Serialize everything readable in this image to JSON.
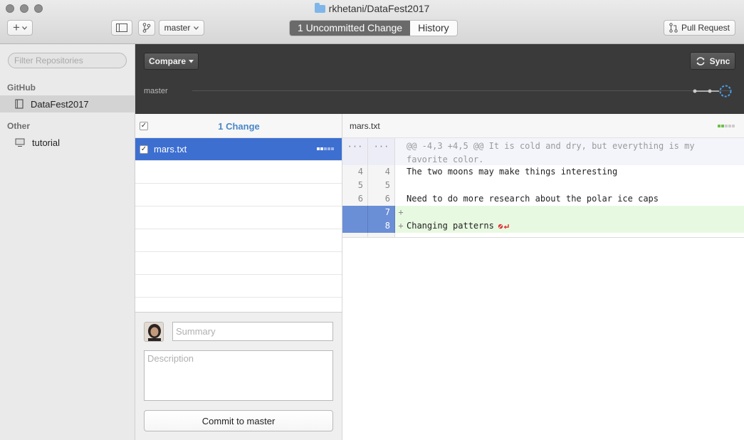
{
  "window": {
    "title": "rkhetani/DataFest2017"
  },
  "toolbar": {
    "add_label": "+",
    "branch_label": "master",
    "tab_changes": "1 Uncommitted Change",
    "tab_history": "History",
    "pull_request_label": "Pull Request"
  },
  "sidebar": {
    "filter_placeholder": "Filter Repositories",
    "groups": [
      {
        "title": "GitHub",
        "repos": [
          {
            "name": "DataFest2017",
            "selected": true
          }
        ]
      },
      {
        "title": "Other",
        "repos": [
          {
            "name": "tutorial",
            "selected": false
          }
        ]
      }
    ]
  },
  "header": {
    "compare_label": "Compare",
    "sync_label": "Sync",
    "branch_name": "master"
  },
  "changes": {
    "count_label": "1 Change",
    "files": [
      {
        "name": "mars.txt",
        "checked": true,
        "selected": true
      }
    ]
  },
  "commit": {
    "summary_placeholder": "Summary",
    "description_placeholder": "Description",
    "button_label": "Commit to master"
  },
  "diff": {
    "filename": "mars.txt",
    "hunk_header_line1": "@@ -4,3 +4,5 @@ It is cold and dry, but everything is my",
    "hunk_header_line2": "favorite color.",
    "gutter_ellipsis": "···",
    "lines": [
      {
        "old": "4",
        "new": "4",
        "sign": "",
        "text": "The two moons may make things interesting"
      },
      {
        "old": "5",
        "new": "5",
        "sign": "",
        "text": ""
      },
      {
        "old": "6",
        "new": "6",
        "sign": "",
        "text": "Need to do more research about the polar ice caps"
      },
      {
        "old": "",
        "new": "7",
        "sign": "+",
        "text": ""
      },
      {
        "old": "",
        "new": "8",
        "sign": "+",
        "text": "Changing patterns"
      }
    ]
  },
  "colors": {
    "accent": "#3d6fd1",
    "added_bg": "#e8f9e1",
    "dark_header": "#3a3a3a"
  }
}
